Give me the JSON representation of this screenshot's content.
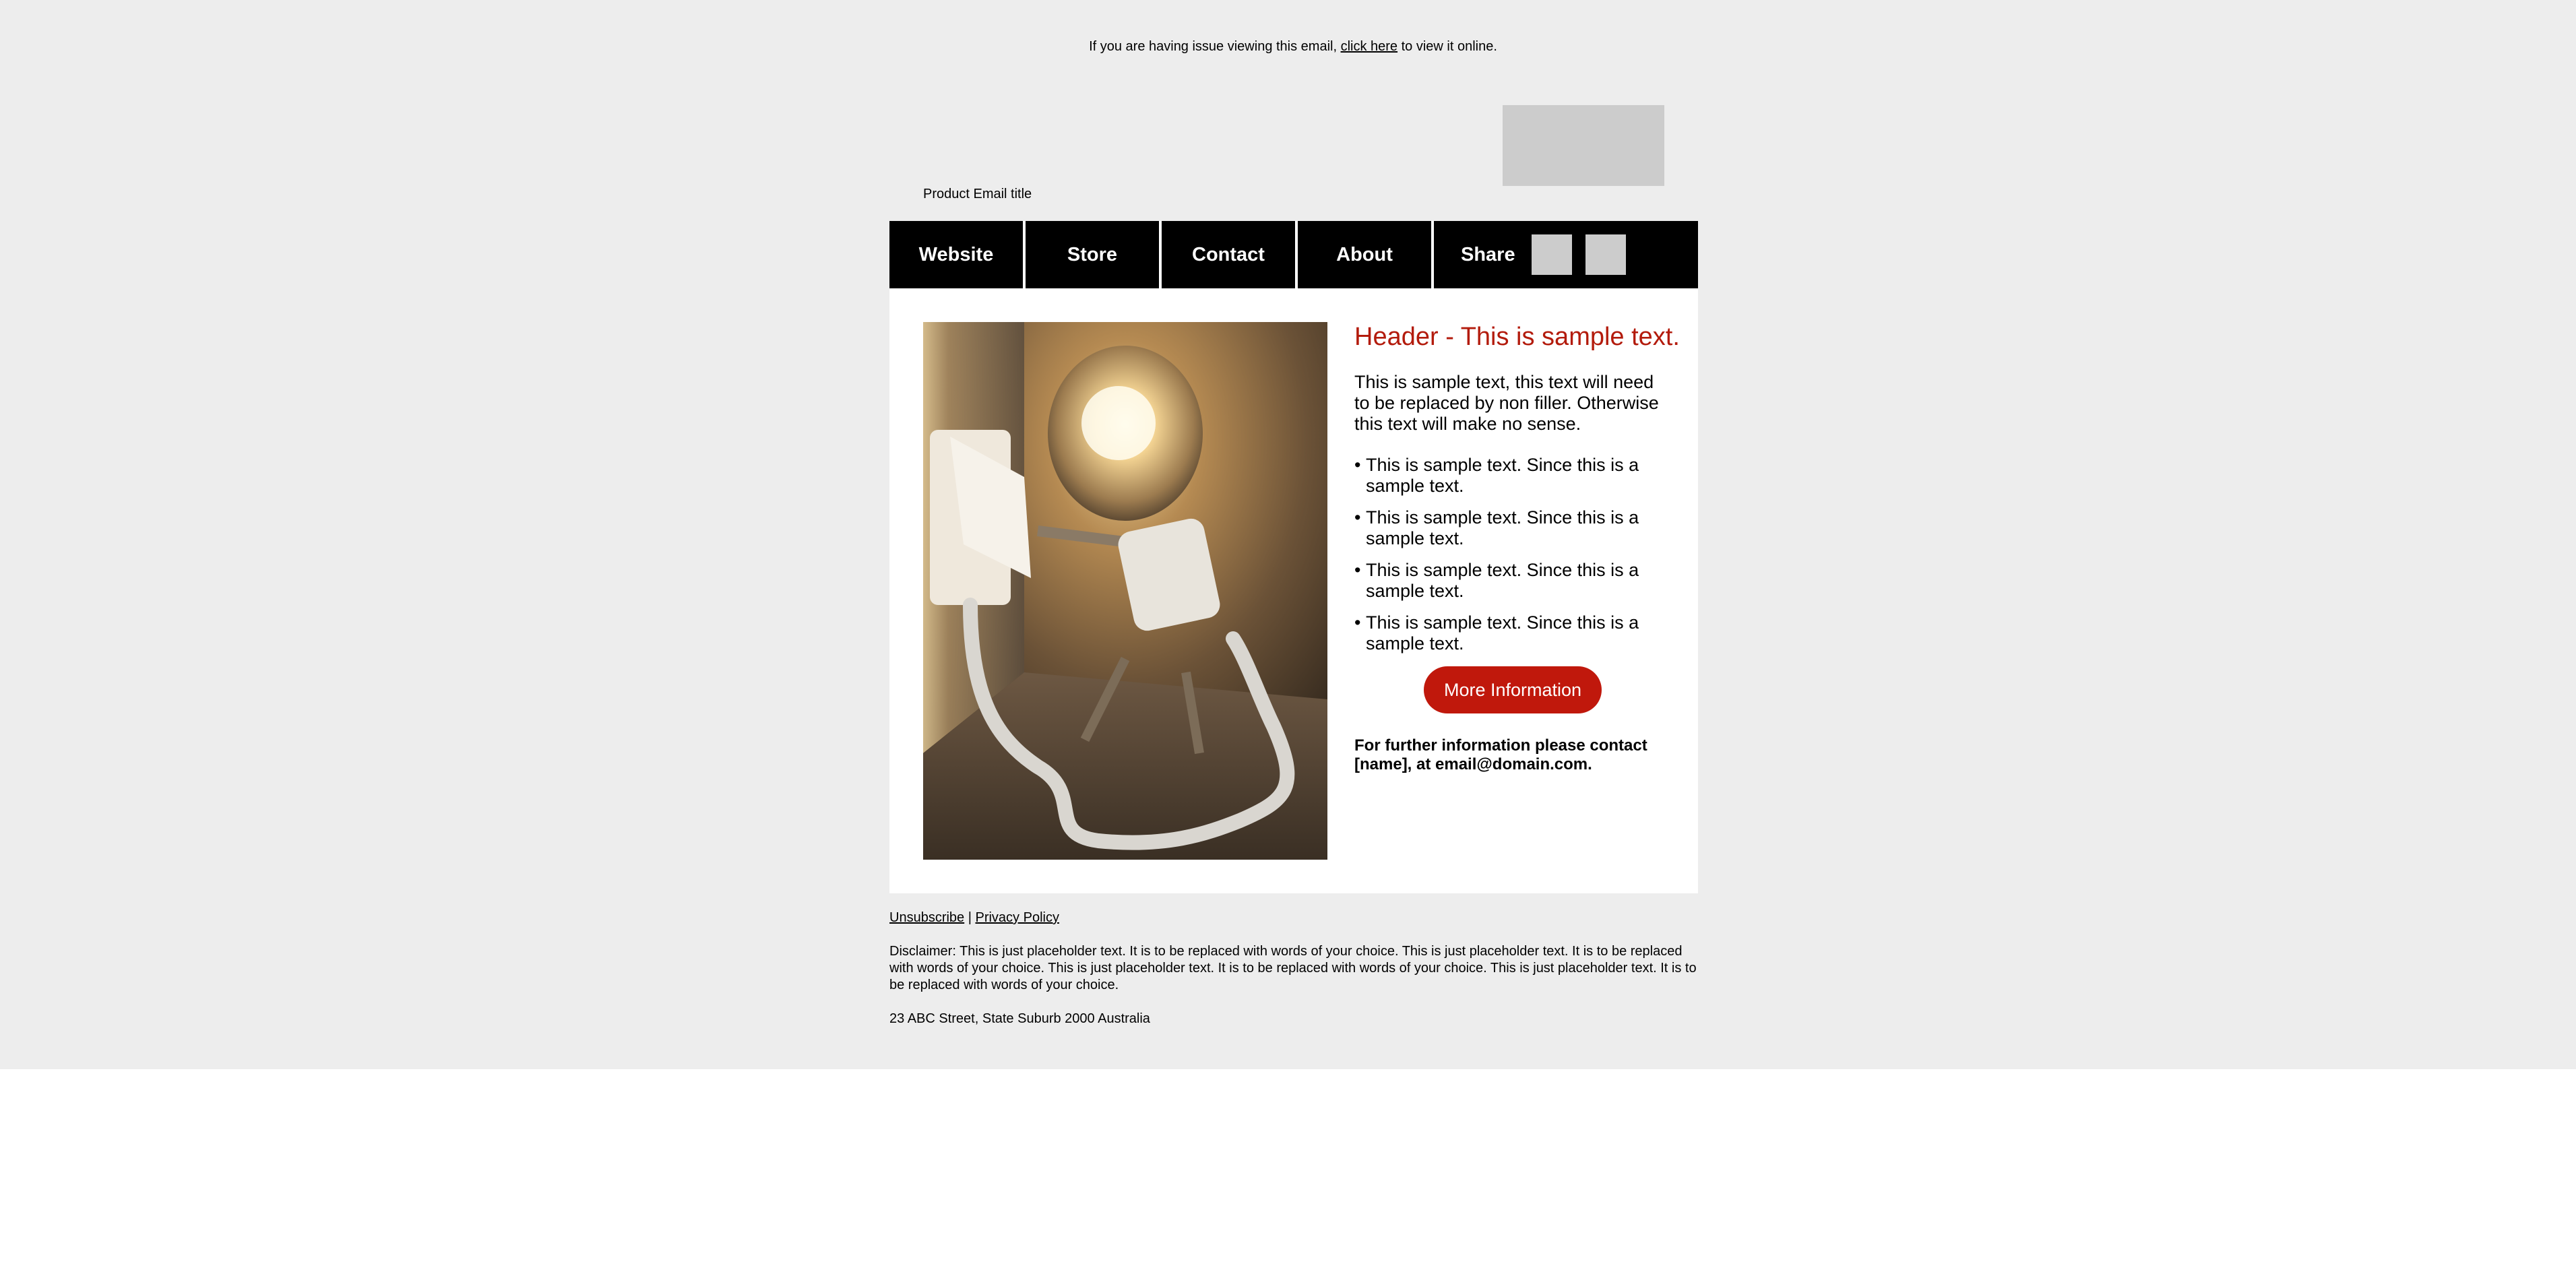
{
  "preheader": {
    "before": "If you are having issue viewing this email, ",
    "link": "click here",
    "after": " to view it online."
  },
  "header": {
    "email_title": "Product Email title"
  },
  "nav": {
    "items": [
      "Website",
      "Store",
      "Contact",
      "About"
    ],
    "share_label": "Share"
  },
  "main": {
    "image_alt": "Light bulb robot plugging into a wall socket",
    "heading": "Header - This is sample text.",
    "intro": "This is sample text, this text will need to be replaced by non filler. Otherwise this text will make no sense.",
    "bullet_char": "•",
    "bullets": [
      "This is sample text. Since this is a sample text.",
      "This is sample text. Since this is a sample text.",
      "This is sample text. Since this is a sample text.",
      "This is sample text. Since this is a sample text."
    ],
    "button_label": "More Information",
    "contact_text": "For further information please contact [name], at email@domain.com."
  },
  "footer": {
    "unsubscribe": "Unsubscribe",
    "separator": " | ",
    "privacy": "Privacy Policy",
    "disclaimer": "Disclaimer: This is just placeholder text. It is to be replaced with words of your choice. This is just placeholder text. It is to be replaced with words of your choice. This is just placeholder text. It is to be replaced with words of your choice. This is just placeholder text. It is to be replaced with words of your choice.",
    "address": "23 ABC Street, State Suburb 2000 Australia"
  },
  "colors": {
    "background": "#ededed",
    "nav_background": "#000000",
    "accent": "#b31b0c",
    "button": "#c0180c",
    "placeholder": "#cccccc"
  }
}
